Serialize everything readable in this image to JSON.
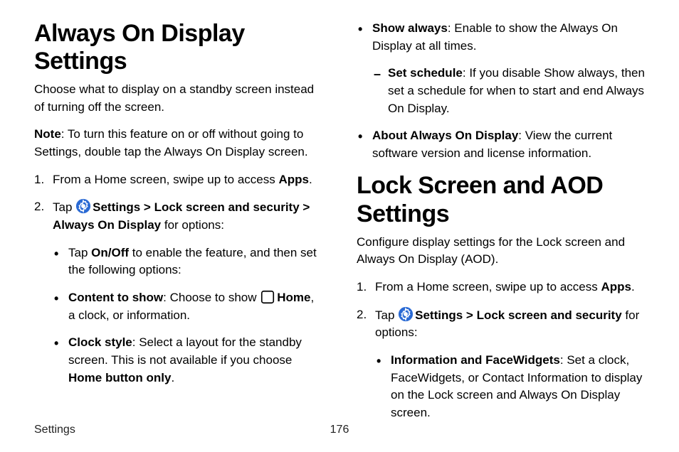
{
  "left": {
    "heading": "Always On Display Settings",
    "intro": "Choose what to display on a standby screen instead of turning off the screen.",
    "note_label": "Note",
    "note_body": ": To turn this feature on or off without going to Settings, double tap the Always On Display screen.",
    "step1_num": "1.",
    "step1_pre": "From a Home screen, swipe up to access ",
    "step1_bold": "Apps",
    "step1_post": ".",
    "step2_num": "2.",
    "step2_pre": "Tap ",
    "step2_settings": "Settings",
    "step2_gt1": " > ",
    "step2_lock": "Lock screen and security",
    "step2_gt2": " > ",
    "step2_aod": "Always On Display",
    "step2_post": " for options:",
    "b1_pre": "Tap ",
    "b1_bold": "On/Off",
    "b1_post": " to enable the feature, and then set the following options:",
    "b2_bold": "Content to show",
    "b2_mid": ": Choose to show ",
    "b2_home": "Home",
    "b2_post": ", a clock, or information.",
    "b3_bold": "Clock style",
    "b3_mid": ": Select a layout for the standby screen. This is not available if you choose ",
    "b3_home_only": "Home button only",
    "b3_post": "."
  },
  "right": {
    "b4_bold": "Show always",
    "b4_post": ": Enable to show the Always On Display at all times.",
    "d1_bold": "Set schedule",
    "d1_post": ": If you disable Show always, then set a schedule for when to start and end Always On Display.",
    "b5_bold": "About Always On Display",
    "b5_post": ": View the current software version and license information.",
    "heading": "Lock Screen and AOD Settings",
    "intro": "Configure display settings for the Lock screen and Always On Display (AOD).",
    "step1_num": "1.",
    "step1_pre": "From a Home screen, swipe up to access ",
    "step1_bold": "Apps",
    "step1_post": ".",
    "step2_num": "2.",
    "step2_pre": "Tap ",
    "step2_settings": "Settings",
    "step2_gt1": " > ",
    "step2_lock": "Lock screen and security",
    "step2_post": " for options:",
    "b6_bold": "Information and FaceWidgets",
    "b6_post": ": Set a clock, FaceWidgets, or Contact Information to display on the Lock screen and Always On Display screen."
  },
  "footer": {
    "left": "Settings",
    "page": "176"
  },
  "icons": {
    "settings_color": "#2a6ad4"
  }
}
